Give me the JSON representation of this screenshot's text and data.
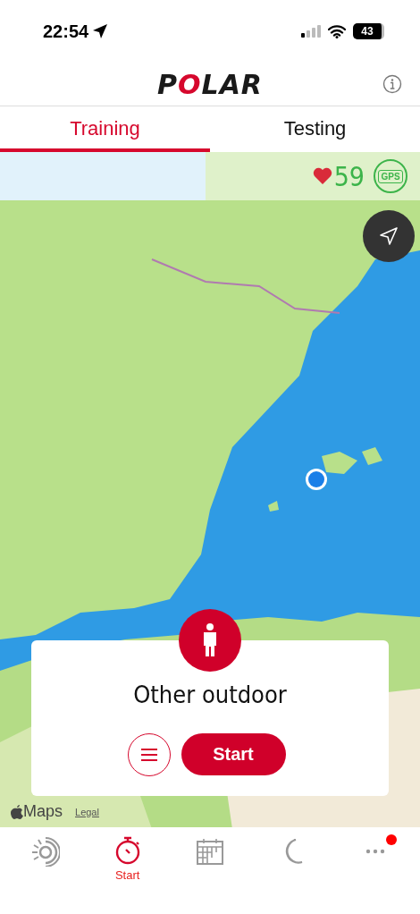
{
  "status_bar": {
    "time": "22:54",
    "battery": "43"
  },
  "header": {
    "logo": "POLAR"
  },
  "tabs": [
    {
      "label": "Training",
      "selected": true
    },
    {
      "label": "Testing",
      "selected": false
    }
  ],
  "map": {
    "heart_rate": "59",
    "gps_label": "GPS",
    "attribution": "Maps",
    "legal": "Legal"
  },
  "activity": {
    "name": "Other outdoor",
    "start_button": "Start"
  },
  "nav": [
    {
      "kind": "activity",
      "selected": false,
      "badge": false
    },
    {
      "kind": "start",
      "label": "Start",
      "selected": true,
      "badge": false
    },
    {
      "kind": "calendar",
      "selected": false,
      "badge": false
    },
    {
      "kind": "sleep",
      "selected": false,
      "badge": false
    },
    {
      "kind": "more",
      "selected": false,
      "badge": true
    }
  ]
}
